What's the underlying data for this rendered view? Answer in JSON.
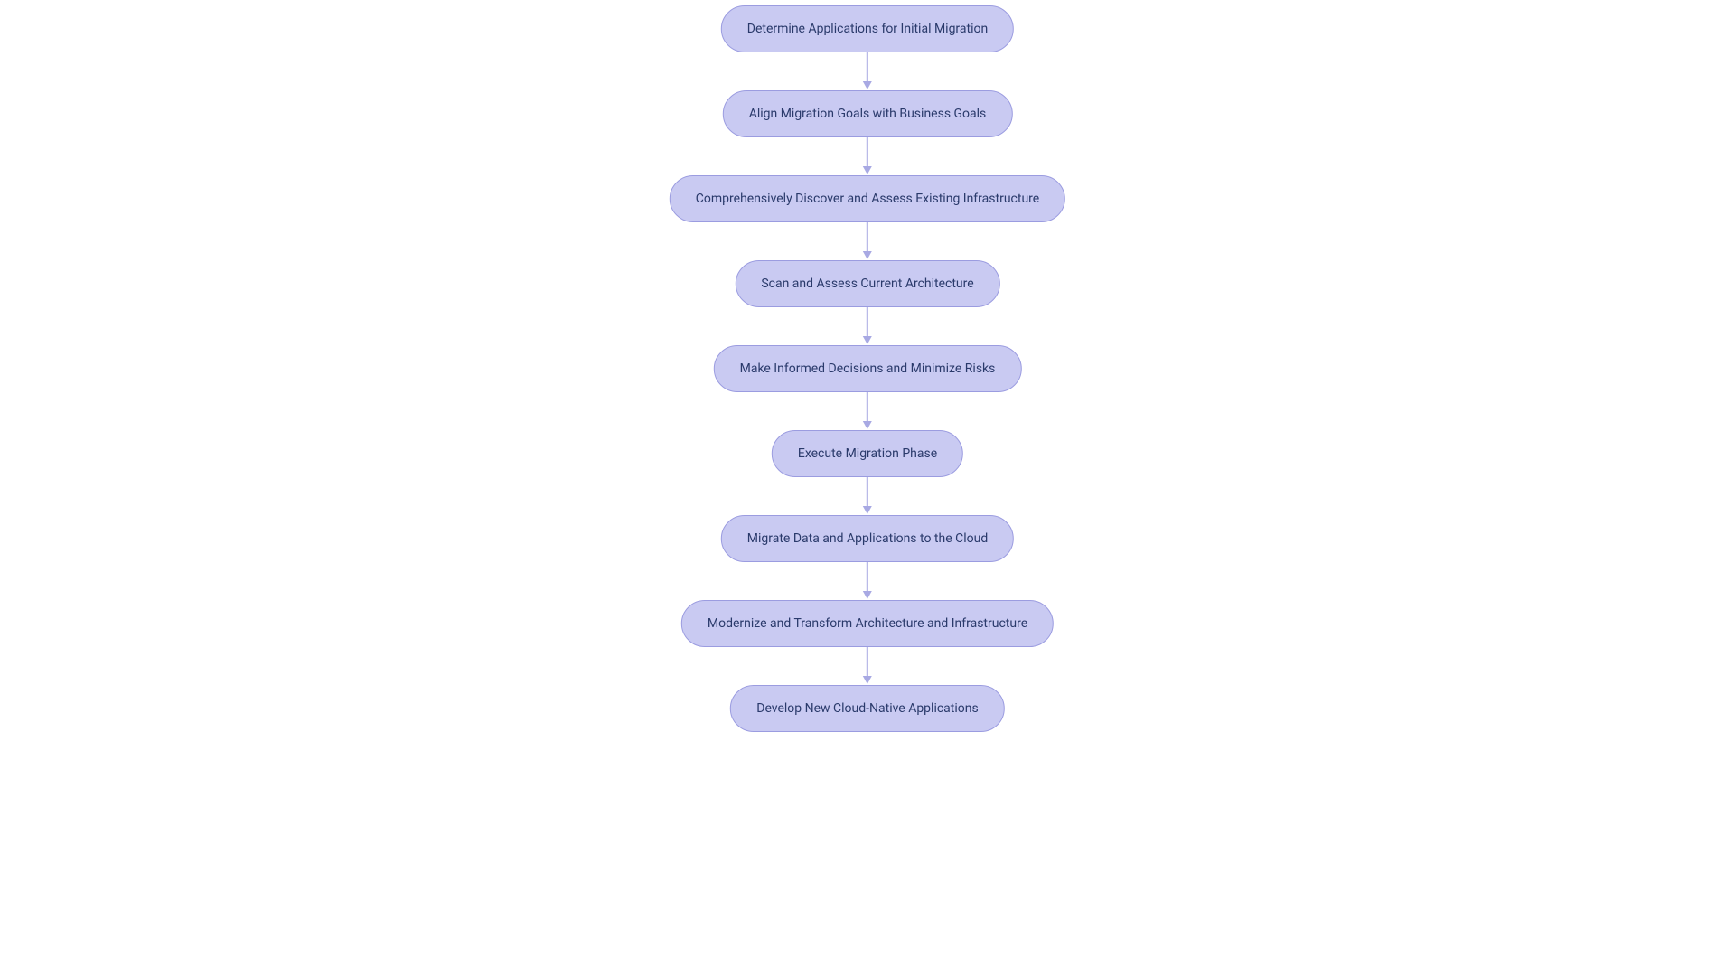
{
  "flowchart": {
    "nodes": [
      {
        "label": "Determine Applications for Initial Migration"
      },
      {
        "label": "Align Migration Goals with Business Goals"
      },
      {
        "label": "Comprehensively Discover and Assess Existing Infrastructure"
      },
      {
        "label": "Scan and Assess Current Architecture"
      },
      {
        "label": "Make Informed Decisions and Minimize Risks"
      },
      {
        "label": "Execute Migration Phase"
      },
      {
        "label": "Migrate Data and Applications to the Cloud"
      },
      {
        "label": "Modernize and Transform Architecture and Infrastructure"
      },
      {
        "label": "Develop New Cloud-Native Applications"
      }
    ]
  },
  "colors": {
    "node_fill": "#c9caf2",
    "node_border": "#9b9ce0",
    "node_text": "#2a3a6b",
    "arrow": "#a8a9e3"
  }
}
